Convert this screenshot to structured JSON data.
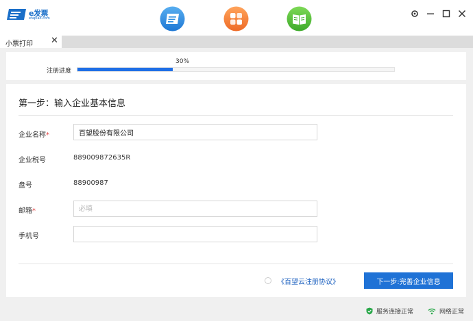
{
  "brand": {
    "name": "e发票",
    "subtitle": "efapiao.com",
    "color": "#1a6fc9"
  },
  "toolbar": {
    "apps": [
      {
        "icon": "invoice-card-icon",
        "color": "#2b8de0"
      },
      {
        "icon": "apps-grid-icon",
        "color": "#f07a2e"
      },
      {
        "icon": "book-icon",
        "color": "#4fbf38"
      }
    ]
  },
  "window_controls": [
    "settings-icon",
    "minimize-icon",
    "maximize-icon",
    "close-icon"
  ],
  "tab": {
    "label": "小票打印"
  },
  "progress": {
    "label": "注册进度",
    "percent_text": "30%",
    "value": 0.3,
    "color": "#1f6fe6"
  },
  "form": {
    "step_title": "第一步：输入企业基本信息",
    "fields": [
      {
        "label": "企业名称",
        "required": "*",
        "value": "百望股份有限公司"
      },
      {
        "label": "企业税号",
        "value": "889009872635R"
      },
      {
        "label": "盘号",
        "value": "88900987"
      },
      {
        "label": "邮箱",
        "required": "*",
        "placeholder": "必填"
      },
      {
        "label": "手机号",
        "value": ""
      }
    ],
    "agreement_link": "《百望云注册协议》",
    "next_button": "下一步:完善企业信息",
    "accent": "#1f72d6"
  },
  "status": {
    "service": "服务连接正常",
    "network": "网络正常",
    "ok_color": "#2aa84a"
  }
}
